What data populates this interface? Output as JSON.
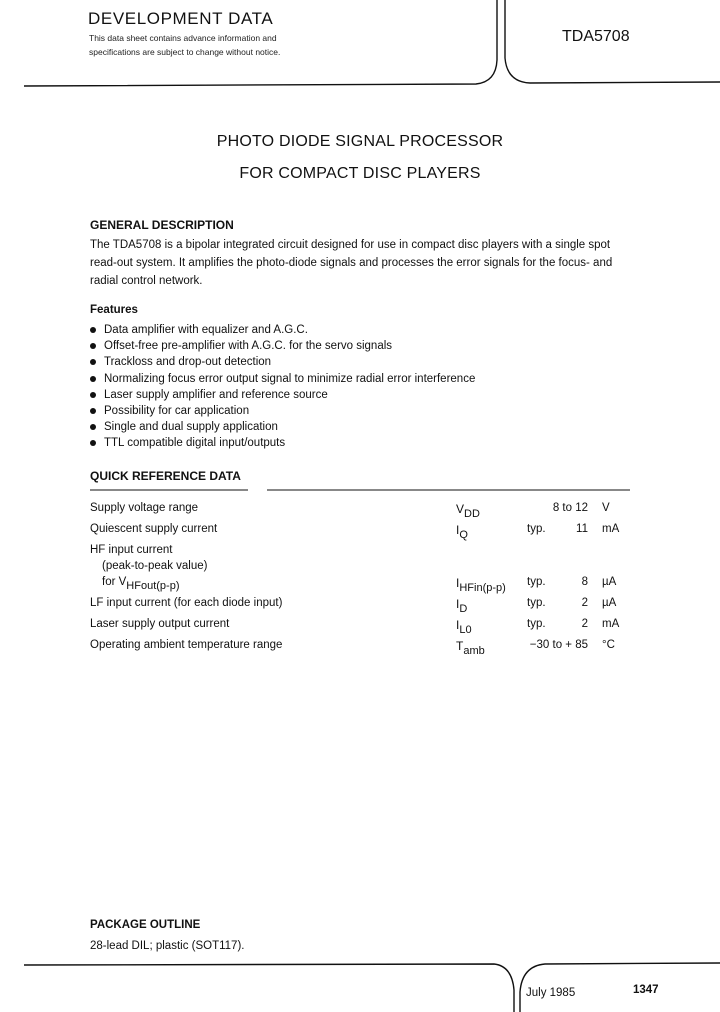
{
  "header": {
    "banner": "DEVELOPMENT DATA",
    "notice_line1": "This data sheet contains advance information and",
    "notice_line2": "specifications are subject to change without notice.",
    "type_number": "TDA5708"
  },
  "title": {
    "line1": "PHOTO DIODE SIGNAL PROCESSOR",
    "line2": "FOR COMPACT DISC PLAYERS"
  },
  "general_description": {
    "heading": "GENERAL DESCRIPTION",
    "lines": [
      "The TDA5708 is a bipolar integrated circuit designed for use in compact disc players with a single spot",
      "read-out system. It amplifies the photo-diode signals and processes the error signals for the focus- and",
      "radial control network."
    ]
  },
  "features": {
    "heading": "Features",
    "items": [
      "Data amplifier with equalizer and A.G.C.",
      "Offset-free pre-amplifier with A.G.C. for the servo signals",
      "Trackloss and drop-out detection",
      "Normalizing focus error output signal to minimize radial error interference",
      "Laser supply amplifier and reference source",
      "Possibility for car application",
      "Single and dual supply application",
      "TTL compatible digital input/outputs"
    ]
  },
  "quick_reference": {
    "heading": "QUICK REFERENCE DATA",
    "rows": [
      {
        "param": "Supply voltage range",
        "sym": "V",
        "sub": "DD",
        "typ": "",
        "val": "8 to 12",
        "unit": "V"
      },
      {
        "param": "Quiescent supply current",
        "sym": "I",
        "sub": "Q",
        "typ": "typ.",
        "val": "11",
        "unit": "mA"
      },
      {
        "param": "HF input current",
        "sym": "",
        "sub": "",
        "typ": "",
        "val": "",
        "unit": ""
      },
      {
        "param": "(peak-to-peak value)",
        "sym": "",
        "sub": "",
        "typ": "",
        "val": "",
        "unit": ""
      },
      {
        "param": "for V",
        "param_sub": "HFout(p-p)",
        "sym": "I",
        "sub": "HFin(p-p)",
        "typ": "typ.",
        "val": "8",
        "unit": "µA"
      },
      {
        "param": "LF input current (for each diode input)",
        "sym": "I",
        "sub": "D",
        "typ": "typ.",
        "val": "2",
        "unit": "µA"
      },
      {
        "param": "Laser supply output current",
        "sym": "I",
        "sub": "L0",
        "typ": "typ.",
        "val": "2",
        "unit": "mA"
      },
      {
        "param": "Operating ambient temperature range",
        "sym": "T",
        "sub": "amb",
        "typ": "",
        "val": "−30 to + 85",
        "unit": "°C"
      }
    ]
  },
  "package_outline": {
    "heading": "PACKAGE OUTLINE",
    "text": "28-lead DIL; plastic (SOT117)."
  },
  "footer": {
    "date": "July 1985",
    "page": "1347"
  }
}
